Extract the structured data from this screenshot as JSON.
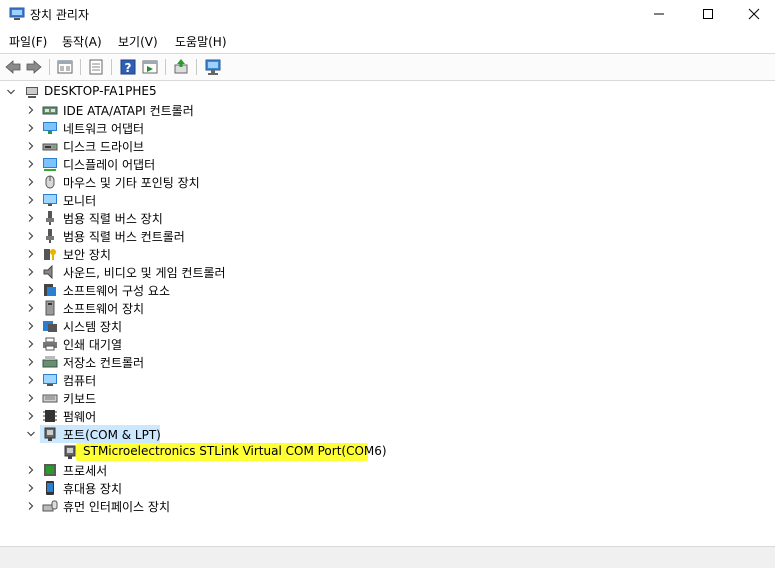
{
  "window": {
    "title": "장치 관리자"
  },
  "menu": [
    "파일(F)",
    "동작(A)",
    "보기(V)",
    "도움말(H)"
  ],
  "tree": {
    "root": "DESKTOP-FA1PHE5",
    "categories": [
      {
        "label": "IDE ATA/ATAPI 컨트롤러",
        "icon": "ide-controller-icon"
      },
      {
        "label": "네트워크 어댑터",
        "icon": "network-adapter-icon"
      },
      {
        "label": "디스크 드라이브",
        "icon": "disk-drive-icon"
      },
      {
        "label": "디스플레이 어댑터",
        "icon": "display-adapter-icon"
      },
      {
        "label": "마우스 및 기타 포인팅 장치",
        "icon": "mouse-icon"
      },
      {
        "label": "모니터",
        "icon": "monitor-icon"
      },
      {
        "label": "범용 직렬 버스 장치",
        "icon": "usb-device-icon"
      },
      {
        "label": "범용 직렬 버스 컨트롤러",
        "icon": "usb-controller-icon"
      },
      {
        "label": "보안 장치",
        "icon": "security-device-icon"
      },
      {
        "label": "사운드, 비디오 및 게임 컨트롤러",
        "icon": "speaker-icon"
      },
      {
        "label": "소프트웨어 구성 요소",
        "icon": "software-component-icon"
      },
      {
        "label": "소프트웨어 장치",
        "icon": "software-device-icon"
      },
      {
        "label": "시스템 장치",
        "icon": "system-device-icon"
      },
      {
        "label": "인쇄 대기열",
        "icon": "printer-icon"
      },
      {
        "label": "저장소 컨트롤러",
        "icon": "storage-controller-icon"
      },
      {
        "label": "컴퓨터",
        "icon": "computer-icon"
      },
      {
        "label": "키보드",
        "icon": "keyboard-icon"
      },
      {
        "label": "펌웨어",
        "icon": "firmware-icon"
      },
      {
        "label": "포트(COM & LPT)",
        "icon": "port-icon",
        "expanded": true,
        "children": [
          {
            "label": "STMicroelectronics STLink Virtual COM Port(COM6)",
            "icon": "port-icon"
          }
        ]
      },
      {
        "label": "프로세서",
        "icon": "processor-icon"
      },
      {
        "label": "휴대용 장치",
        "icon": "portable-device-icon"
      },
      {
        "label": "휴먼 인터페이스 장치",
        "icon": "hid-icon"
      }
    ]
  },
  "colors": {
    "selection": "#cce8ff",
    "highlight": "#ffff33"
  }
}
